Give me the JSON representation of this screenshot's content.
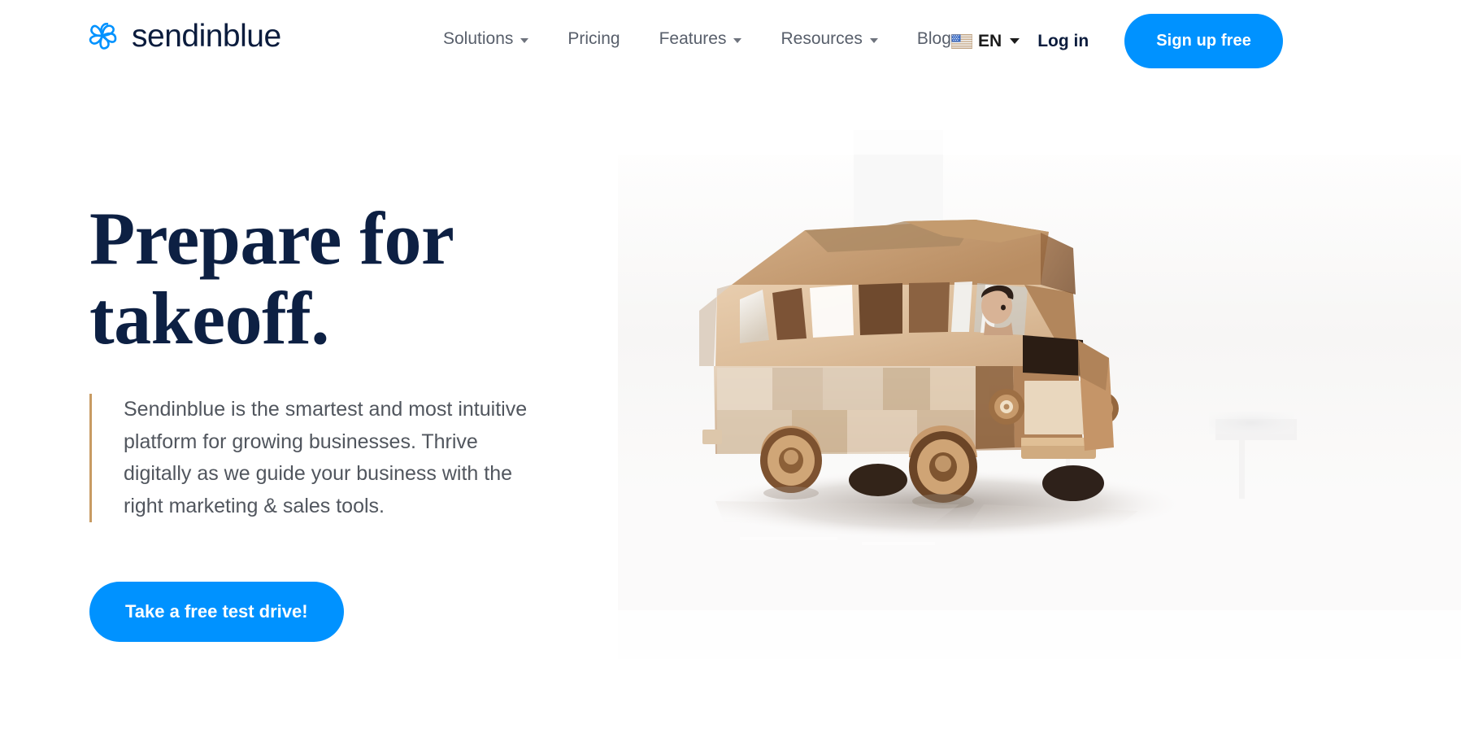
{
  "brand": {
    "name": "sendinblue",
    "logo_icon": "sendinblue-pinwheel-icon",
    "accent_blue": "#0092ff",
    "navy": "#0d2043",
    "accent_bar_color": "#c89b63"
  },
  "header": {
    "nav_items": [
      {
        "label": "Solutions",
        "has_dropdown": true
      },
      {
        "label": "Pricing",
        "has_dropdown": false
      },
      {
        "label": "Features",
        "has_dropdown": true
      },
      {
        "label": "Resources",
        "has_dropdown": true
      },
      {
        "label": "Blog",
        "has_dropdown": false
      }
    ],
    "language": {
      "code": "EN",
      "flag_icon": "us-flag-icon",
      "caret_icon": "chevron-down-icon"
    },
    "login_label": "Log in",
    "signup_label": "Sign up free"
  },
  "hero": {
    "title_line_1": "Prepare for",
    "title_line_2": "takeoff.",
    "paragraph": "Sendinblue is the smartest and most intuitive platform for growing businesses. Thrive digitally as we guide your business with the right marketing & sales tools.",
    "cta_label": "Take a free test drive!",
    "image_description": "wooden-toy-van-with-driver"
  }
}
